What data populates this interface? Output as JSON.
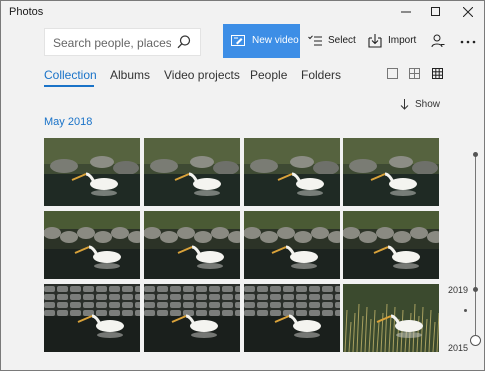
{
  "app": {
    "title": "Photos"
  },
  "toolbar": {
    "search_placeholder": "Search people, places, or things",
    "new_video_label": "New video",
    "select_label": "Select",
    "import_label": "Import"
  },
  "icons": {
    "search": "search-icon",
    "new_video": "video-edit-icon",
    "select": "select-list-icon",
    "import": "import-icon",
    "account": "person-add-icon",
    "more": "more-ellipsis-icon",
    "minimize": "minimize-icon",
    "maximize": "maximize-icon",
    "close": "close-icon"
  },
  "nav": {
    "tabs": [
      {
        "label": "Collection",
        "active": true
      },
      {
        "label": "Albums",
        "active": false
      },
      {
        "label": "Video projects",
        "active": false
      },
      {
        "label": "People",
        "active": false
      },
      {
        "label": "Folders",
        "active": false
      }
    ]
  },
  "view": {
    "modes": [
      "large-tiles",
      "medium-tiles",
      "small-tiles"
    ],
    "selected": "small-tiles",
    "show_label": "Show"
  },
  "section": {
    "title": "May 2018"
  },
  "photos": [
    {
      "subject": "white pelican on water near rocks"
    },
    {
      "subject": "white pelican on water near rocks"
    },
    {
      "subject": "white pelican on water near rocks"
    },
    {
      "subject": "white pelican on water near rocks"
    },
    {
      "subject": "white pelican swimming by rock wall"
    },
    {
      "subject": "white pelican swimming by rock wall"
    },
    {
      "subject": "white pelican swimming by rock wall"
    },
    {
      "subject": "white pelican swimming by rock wall"
    },
    {
      "subject": "white pelican by stone wall"
    },
    {
      "subject": "white pelican by stone wall"
    },
    {
      "subject": "white pelican by stone wall"
    },
    {
      "subject": "white pelican among reeds"
    }
  ],
  "timeline": {
    "labels": [
      "2019",
      "2015"
    ]
  },
  "colors": {
    "accent": "#1a73c8",
    "new_video_bg": "#3d8ee6",
    "background": "#f2f2f2"
  }
}
